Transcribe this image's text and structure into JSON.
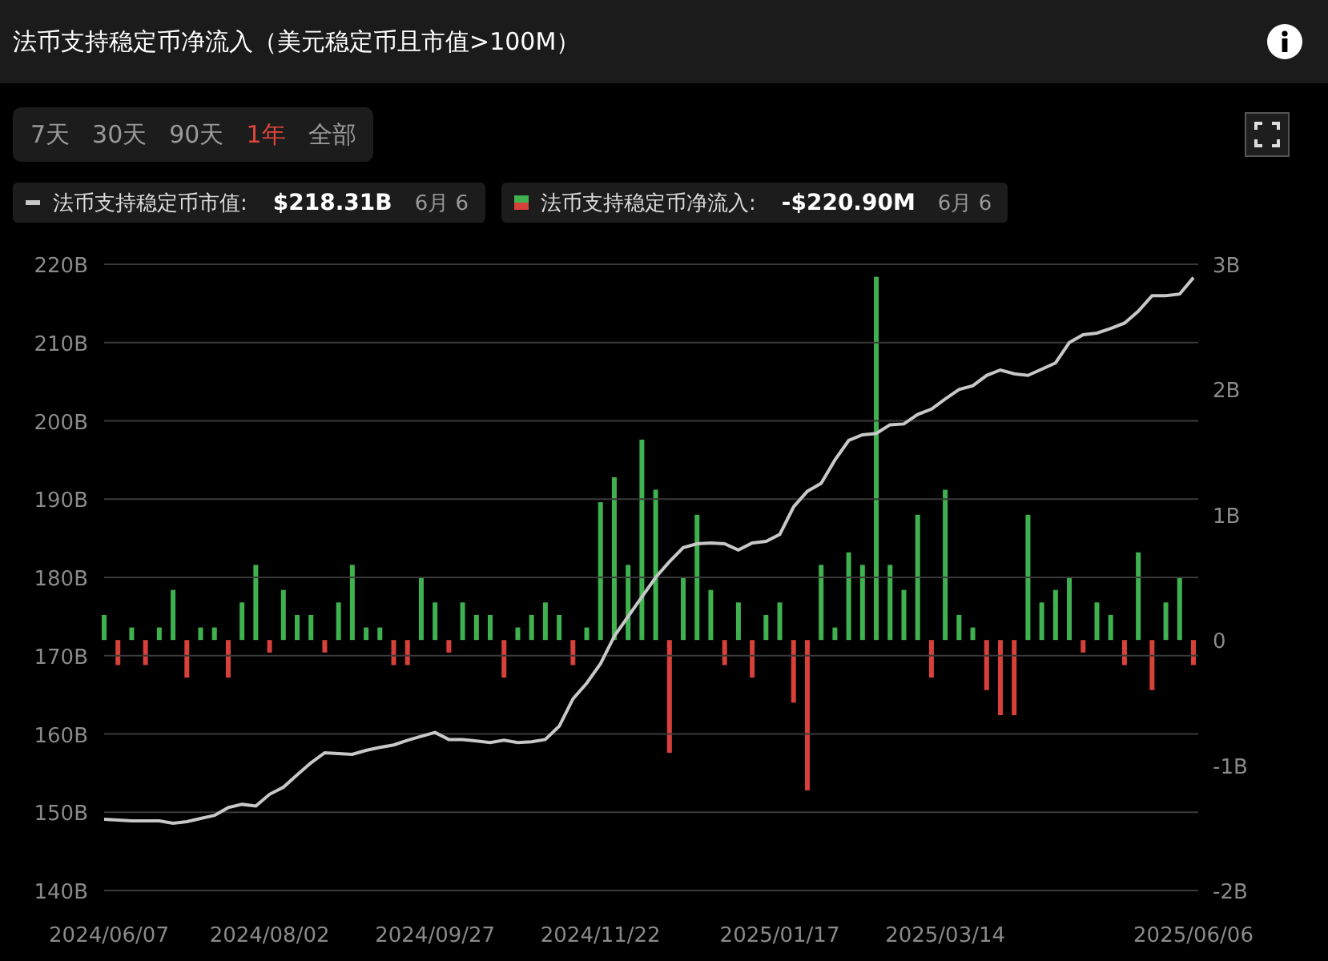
{
  "header": {
    "title": "法币支持稳定币净流入（美元稳定币且市值>100M）"
  },
  "range_tabs": [
    {
      "label": "7天",
      "selected": false
    },
    {
      "label": "30天",
      "selected": false
    },
    {
      "label": "90天",
      "selected": false
    },
    {
      "label": "1年",
      "selected": true
    },
    {
      "label": "全部",
      "selected": false
    }
  ],
  "legend": [
    {
      "kind": "line",
      "label": "法币支持稳定币市值:",
      "value": "$218.31B",
      "date": "6月 6"
    },
    {
      "kind": "bar",
      "label": "法币支持稳定币净流入:",
      "value": "-$220.90M",
      "date": "6月 6"
    }
  ],
  "charts": [
    {
      "chart_data": {
        "type": "line",
        "grid": true,
        "categories": [
          null,
          null,
          null,
          null,
          null,
          null,
          null,
          null,
          null,
          null,
          null,
          null,
          null,
          null,
          null,
          null,
          null,
          null,
          null,
          null,
          null,
          null,
          null,
          null,
          null,
          null,
          null,
          null,
          null,
          null,
          null,
          null,
          null,
          null,
          null,
          null,
          null,
          null,
          null,
          null,
          null,
          null,
          null,
          null,
          null,
          null,
          null,
          null,
          null,
          null,
          null,
          null,
          null,
          null,
          null,
          null,
          null,
          null,
          null,
          null,
          null,
          null,
          null,
          null,
          null,
          null,
          null,
          null,
          null,
          null,
          null,
          null,
          null,
          null,
          null,
          null,
          null,
          null,
          null,
          null
        ],
        "ylim": [
          140,
          220
        ],
        "yticks": [
          {
            "value": 220,
            "label": "220B"
          },
          {
            "value": 210,
            "label": "210B"
          },
          {
            "value": 200,
            "label": "200B"
          },
          {
            "value": 190,
            "label": "190B"
          },
          {
            "value": 180,
            "label": "180B"
          },
          {
            "value": 170,
            "label": "170B"
          },
          {
            "value": 160,
            "label": "160B"
          },
          {
            "value": 150,
            "label": "150B"
          },
          {
            "value": 140,
            "label": "140B"
          }
        ],
        "series": [
          {
            "color": "#c8c8c8",
            "values": [
              149.1,
              149.0,
              148.9,
              148.9,
              148.9,
              148.6,
              148.8,
              149.2,
              149.6,
              150.6,
              151.0,
              150.8,
              152.3,
              153.2,
              154.8,
              156.3,
              157.6,
              157.5,
              157.4,
              157.9,
              158.3,
              158.6,
              159.2,
              159.7,
              160.2,
              159.3,
              159.3,
              159.1,
              158.9,
              159.2,
              158.9,
              159.0,
              159.3,
              161.0,
              164.5,
              166.5,
              169.0,
              172.5,
              175.0,
              177.5,
              180.0,
              182.0,
              183.8,
              184.3,
              184.4,
              184.3,
              183.5,
              184.4,
              184.6,
              185.5,
              189.0,
              191.0,
              192.0,
              195.0,
              197.5,
              198.2,
              198.4,
              199.5,
              199.6,
              200.8,
              201.5,
              202.8,
              204.0,
              204.5,
              205.8,
              206.5,
              206.0,
              205.8,
              206.6,
              207.4,
              210.0,
              211.0,
              211.2,
              211.8,
              212.5,
              214.0,
              216.0,
              216.0,
              216.2,
              218.3
            ]
          }
        ]
      }
    },
    {
      "chart_data": {
        "type": "bar",
        "categories": [
          "2024/06/07",
          null,
          null,
          null,
          null,
          null,
          null,
          null,
          null,
          null,
          null,
          null,
          "2024/08/02",
          null,
          null,
          null,
          null,
          null,
          null,
          null,
          null,
          null,
          null,
          null,
          "2024/09/27",
          null,
          null,
          null,
          null,
          null,
          null,
          null,
          null,
          null,
          null,
          null,
          "2024/11/22",
          null,
          null,
          null,
          null,
          null,
          null,
          null,
          null,
          null,
          null,
          null,
          null,
          "2025/01/17",
          null,
          null,
          null,
          null,
          null,
          null,
          null,
          null,
          null,
          null,
          null,
          "2025/03/14",
          null,
          null,
          null,
          null,
          null,
          null,
          null,
          null,
          null,
          null,
          null,
          null,
          null,
          null,
          null,
          null,
          null,
          "2025/06/06"
        ],
        "ylim": [
          -2,
          3
        ],
        "yticks": [
          {
            "value": 3,
            "label": "3B"
          },
          {
            "value": 2,
            "label": "2B"
          },
          {
            "value": 1,
            "label": "1B"
          },
          {
            "value": 0,
            "label": "0"
          },
          {
            "value": -1,
            "label": "-1B"
          },
          {
            "value": -2,
            "label": "-2B"
          }
        ],
        "series": [
          {
            "color": "#3fb24f",
            "values": [
              0.2,
              null,
              0.1,
              null,
              0.1,
              0.4,
              null,
              0.1,
              0.1,
              null,
              0.3,
              0.6,
              null,
              0.4,
              0.2,
              0.2,
              null,
              0.3,
              0.6,
              0.1,
              0.1,
              null,
              null,
              0.5,
              0.3,
              null,
              0.3,
              0.2,
              0.2,
              null,
              0.1,
              0.2,
              0.3,
              0.2,
              null,
              0.1,
              1.1,
              1.3,
              0.6,
              1.6,
              1.2,
              null,
              0.5,
              1.0,
              0.4,
              null,
              0.3,
              null,
              0.2,
              0.3,
              null,
              null,
              0.6,
              0.1,
              0.7,
              0.6,
              2.9,
              0.6,
              0.4,
              1.0,
              null,
              1.2,
              0.2,
              0.1,
              null,
              null,
              null,
              1.0,
              0.3,
              0.4,
              0.5,
              null,
              0.3,
              0.2,
              null,
              0.7,
              null,
              0.3,
              0.5,
              null
            ]
          },
          {
            "color": "#d8403a",
            "values": [
              null,
              -0.2,
              null,
              -0.2,
              null,
              null,
              -0.3,
              null,
              null,
              -0.3,
              null,
              null,
              -0.1,
              null,
              null,
              null,
              -0.1,
              null,
              null,
              null,
              null,
              -0.2,
              -0.2,
              null,
              null,
              -0.1,
              null,
              null,
              null,
              -0.3,
              null,
              null,
              null,
              null,
              -0.2,
              null,
              null,
              null,
              null,
              null,
              null,
              -0.9,
              null,
              null,
              null,
              -0.2,
              null,
              -0.3,
              null,
              null,
              -0.5,
              -1.2,
              null,
              null,
              null,
              null,
              null,
              null,
              null,
              null,
              -0.3,
              null,
              null,
              null,
              -0.4,
              -0.6,
              -0.6,
              null,
              null,
              null,
              null,
              -0.1,
              null,
              null,
              -0.2,
              null,
              -0.4,
              null,
              null,
              -0.2
            ]
          }
        ]
      }
    }
  ]
}
